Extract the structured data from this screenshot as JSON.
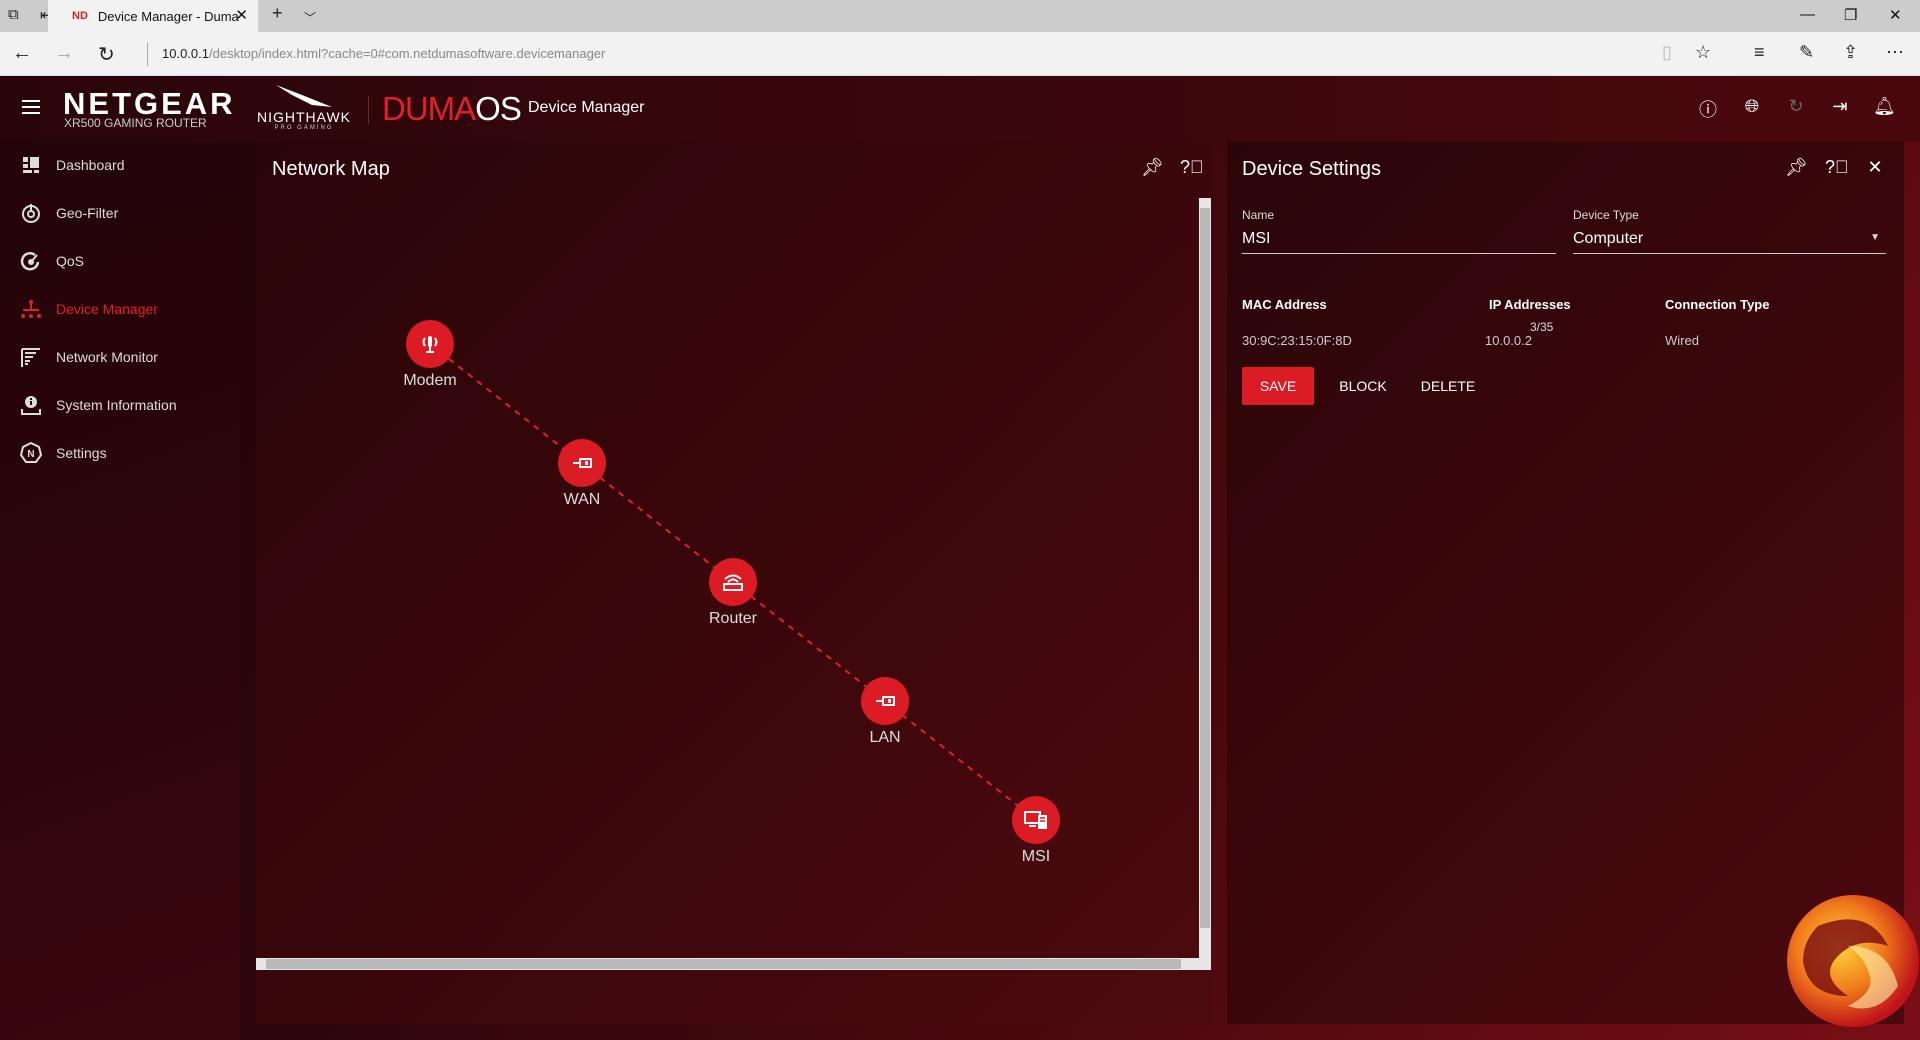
{
  "browser": {
    "tab_title": "Device Manager - Duma",
    "tab_favicon": "ND",
    "url_host": "10.0.0.1",
    "url_path": "/desktop/index.html?cache=0#com.netdumasoftware.devicemanager"
  },
  "header": {
    "brand": "NETGEAR",
    "brand_sub": "XR500 GAMING ROUTER",
    "nighthawk": "NIGHTHAWK",
    "nighthawk_sub": "PRO GAMING",
    "duma": "DUMA",
    "os": "OS",
    "title": "Device Manager"
  },
  "sidebar": {
    "items": [
      {
        "label": "Dashboard",
        "icon": "dashboard-icon"
      },
      {
        "label": "Geo-Filter",
        "icon": "geo-filter-icon"
      },
      {
        "label": "QoS",
        "icon": "qos-icon"
      },
      {
        "label": "Device Manager",
        "icon": "device-manager-icon",
        "active": true
      },
      {
        "label": "Network Monitor",
        "icon": "network-monitor-icon"
      },
      {
        "label": "System Information",
        "icon": "system-info-icon"
      },
      {
        "label": "Settings",
        "icon": "settings-icon"
      }
    ]
  },
  "network_map": {
    "title": "Network Map",
    "nodes": [
      {
        "label": "Modem",
        "icon": "modem-icon"
      },
      {
        "label": "WAN",
        "icon": "ethernet-icon"
      },
      {
        "label": "Router",
        "icon": "router-icon"
      },
      {
        "label": "LAN",
        "icon": "ethernet-icon"
      },
      {
        "label": "MSI",
        "icon": "computer-icon"
      }
    ]
  },
  "device_settings": {
    "title": "Device Settings",
    "name_label": "Name",
    "name_value": "MSI",
    "name_counter": "3/35",
    "type_label": "Device Type",
    "type_value": "Computer",
    "columns": [
      "MAC Address",
      "IP Addresses",
      "Connection Type"
    ],
    "values": [
      "30:9C:23:15:0F:8D",
      "10.0.0.2",
      "Wired"
    ],
    "save": "SAVE",
    "block": "BLOCK",
    "delete": "DELETE"
  },
  "colors": {
    "accent": "#dc1c24",
    "background": "#3a070b"
  }
}
